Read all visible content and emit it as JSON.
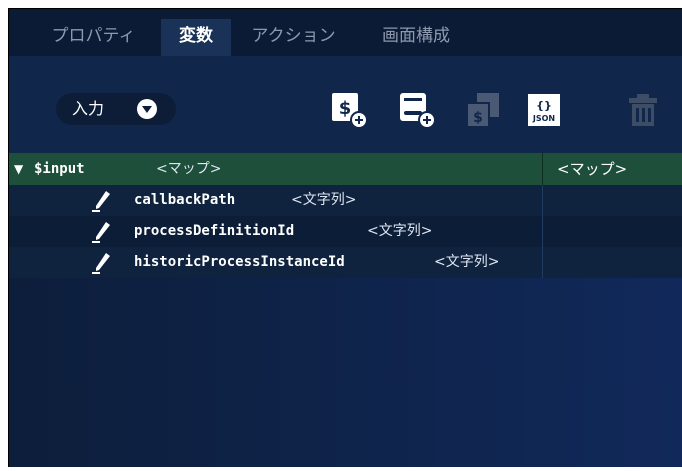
{
  "tabs": [
    {
      "label": "プロパティ",
      "active": false
    },
    {
      "label": "変数",
      "active": true
    },
    {
      "label": "アクション",
      "active": false
    },
    {
      "label": "画面構成",
      "active": false
    }
  ],
  "toolbar": {
    "dropdown_value": "入力",
    "tools": [
      {
        "icon": "add-variable-icon",
        "enabled": true
      },
      {
        "icon": "add-field-icon",
        "enabled": true
      },
      {
        "icon": "copy-variable-icon",
        "enabled": false
      },
      {
        "icon": "json-icon",
        "label": "JSON",
        "enabled": true
      },
      {
        "icon": "trash-icon",
        "enabled": false
      }
    ]
  },
  "tree": {
    "root": {
      "toggle": "▼",
      "key": "$input",
      "type": "<マップ>",
      "value_type": "<マップ>"
    },
    "children": [
      {
        "key": "callbackPath",
        "type": "<文字列>"
      },
      {
        "key": "processDefinitionId",
        "type": "<文字列>"
      },
      {
        "key": "historicProcessInstanceId",
        "type": "<文字列>"
      }
    ]
  },
  "colors": {
    "panel_bg": "#0e2142",
    "selected_row": "#1d4f3a",
    "tab_active": "#1a3158"
  }
}
